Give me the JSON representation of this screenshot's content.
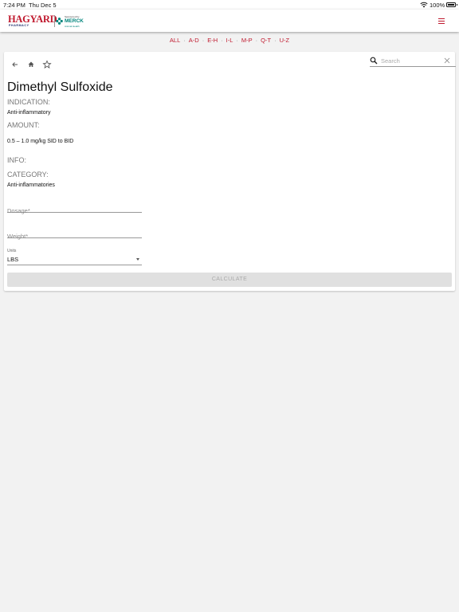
{
  "status_bar": {
    "time": "7:24 PM",
    "date": "Thu Dec 5",
    "battery": "100%"
  },
  "header": {
    "logo_name": "HAGYARD",
    "logo_sub": "PHARMACY",
    "sponsor_text": "Sponsored by",
    "sponsor_name": "MERCK",
    "sponsor_sub": "Animal Health",
    "accent_color": "#c0192e",
    "sponsor_color": "#00857c",
    "menu_icon": "hamburger-menu-icon"
  },
  "alpha_nav": [
    "ALL",
    "A-D",
    "E-H",
    "I-L",
    "M-P",
    "Q-T",
    "U-Z"
  ],
  "alpha_separator": "·",
  "toolbar": {
    "back_icon": "arrow-left-icon",
    "home_icon": "home-icon",
    "favorite_icon": "star-outline-icon"
  },
  "search": {
    "placeholder": "Search",
    "value": ""
  },
  "drug": {
    "name": "Dimethyl Sulfoxide",
    "indication_label": "INDICATION:",
    "indication": "Anti-inflammatory",
    "amount_label": "AMOUNT:",
    "amount": "0.5 – 1.0 mg/kg SID to BID",
    "info_label": "INFO:",
    "info": "",
    "category_label": "CATEGORY:",
    "category": "Anti-inflammatories"
  },
  "form": {
    "dosage_placeholder": "Dosage*",
    "weight_placeholder": "Weight*",
    "units_label": "Units",
    "units_value": "LBS",
    "calculate_label": "CALCULATE"
  }
}
